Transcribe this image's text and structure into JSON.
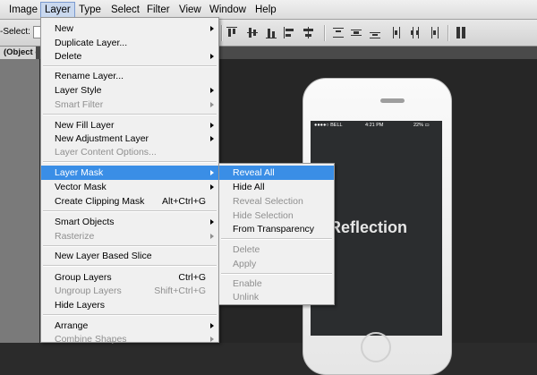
{
  "menubar": {
    "items": [
      {
        "label": "Image"
      },
      {
        "label": "Layer"
      },
      {
        "label": "Type"
      },
      {
        "label": "Select"
      },
      {
        "label": "Filter"
      },
      {
        "label": "View"
      },
      {
        "label": "Window"
      },
      {
        "label": "Help"
      }
    ],
    "active": "Layer"
  },
  "options_bar": {
    "auto_select_label": "-Select:"
  },
  "document": {
    "tab_label": "(Object co"
  },
  "phone": {
    "carrier": "●●●●○ BELL",
    "time": "4:21 PM",
    "battery": "22% ▭",
    "screen_text": "Reflection"
  },
  "layer_menu": {
    "items": [
      {
        "label": "New",
        "submenu": true
      },
      {
        "label": "Duplicate Layer..."
      },
      {
        "label": "Delete",
        "submenu": true
      },
      {
        "label": "Rename Layer..."
      },
      {
        "label": "Layer Style",
        "submenu": true
      },
      {
        "label": "Smart Filter",
        "disabled": true,
        "submenu": true
      },
      {
        "label": "New Fill Layer",
        "submenu": true
      },
      {
        "label": "New Adjustment Layer",
        "submenu": true
      },
      {
        "label": "Layer Content Options...",
        "disabled": true
      },
      {
        "label": "Layer Mask",
        "submenu": true,
        "highlighted": true
      },
      {
        "label": "Vector Mask",
        "submenu": true
      },
      {
        "label": "Create Clipping Mask",
        "shortcut": "Alt+Ctrl+G"
      },
      {
        "label": "Smart Objects",
        "submenu": true
      },
      {
        "label": "Rasterize",
        "disabled": true,
        "submenu": true
      },
      {
        "label": "New Layer Based Slice"
      },
      {
        "label": "Group Layers",
        "shortcut": "Ctrl+G"
      },
      {
        "label": "Ungroup Layers",
        "shortcut": "Shift+Ctrl+G",
        "disabled": true
      },
      {
        "label": "Hide Layers"
      },
      {
        "label": "Arrange",
        "submenu": true
      },
      {
        "label": "Combine Shapes",
        "disabled": true,
        "submenu": true
      }
    ]
  },
  "layer_mask_submenu": {
    "items": [
      {
        "label": "Reveal All",
        "highlighted": true
      },
      {
        "label": "Hide All"
      },
      {
        "label": "Reveal Selection",
        "disabled": true
      },
      {
        "label": "Hide Selection",
        "disabled": true
      },
      {
        "label": "From Transparency"
      },
      {
        "label": "Delete",
        "disabled": true
      },
      {
        "label": "Apply",
        "disabled": true
      },
      {
        "label": "Enable",
        "disabled": true
      },
      {
        "label": "Unlink",
        "disabled": true
      }
    ]
  }
}
